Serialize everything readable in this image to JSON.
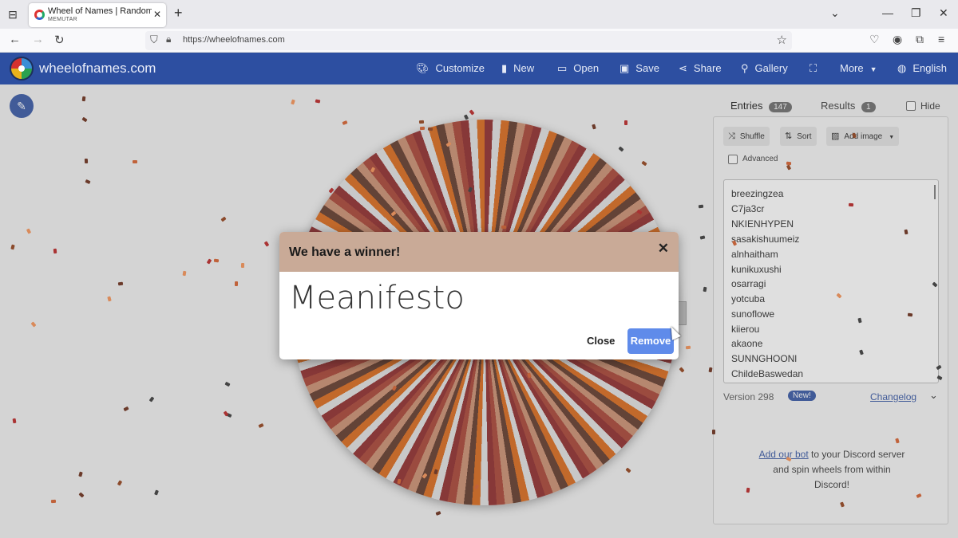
{
  "browser": {
    "tab_title": "Wheel of Names | Random nam",
    "tab_subtitle": "MEMUTAR",
    "url": "https://wheelofnames.com"
  },
  "header": {
    "brand": "wheelofnames.com",
    "menu": [
      {
        "label": "Customize",
        "icon": "palette-icon"
      },
      {
        "label": "New",
        "icon": "file-icon"
      },
      {
        "label": "Open",
        "icon": "folder-icon"
      },
      {
        "label": "Save",
        "icon": "save-icon"
      },
      {
        "label": "Share",
        "icon": "share-icon"
      },
      {
        "label": "Gallery",
        "icon": "search-icon"
      },
      {
        "label": "",
        "icon": "fullscreen-icon"
      },
      {
        "label": "More",
        "icon": "chevron-down-icon"
      },
      {
        "label": "English",
        "icon": "globe-icon"
      }
    ]
  },
  "modal": {
    "title": "We have a winner!",
    "winner": "Meanifesto",
    "close_label": "Close",
    "remove_label": "Remove"
  },
  "sidebar": {
    "tabs": {
      "entries_label": "Entries",
      "entries_count": "147",
      "results_label": "Results",
      "results_count": "1"
    },
    "hide_label": "Hide",
    "tools": {
      "shuffle": "Shuffle",
      "sort": "Sort",
      "add_image": "Add image"
    },
    "advanced_label": "Advanced",
    "entries": [
      "breezingzea",
      "C7ja3cr",
      "NKIENHYPEN",
      "sasakishuumeiz",
      "alnhaitham",
      "kunikuxushi",
      "osarragi",
      "yotcuba",
      "sunoflowe",
      "kiierou",
      "akaone",
      "SUNNGHOONl",
      "ChildeBaswedan"
    ],
    "version": "Version 298",
    "new_badge": "New!",
    "changelog": "Changelog",
    "discord": {
      "link": "Add our bot",
      "text1": " to your Discord server",
      "text2": "and spin wheels from within",
      "text3": "Discord!"
    }
  },
  "colors": {
    "header_bg": "#2d4fa1",
    "modal_header": "#c9aa97",
    "remove_button": "#5f8bea"
  }
}
